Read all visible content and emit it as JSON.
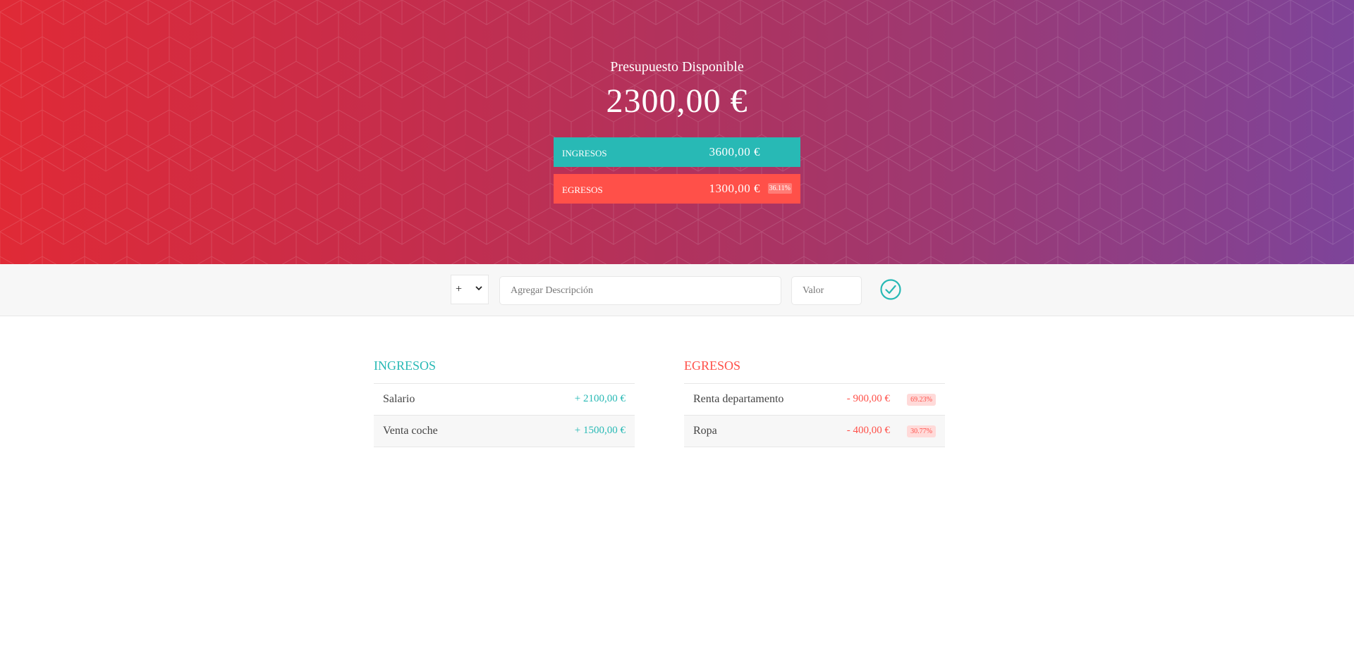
{
  "header": {
    "title": "Presupuesto Disponible",
    "budget_value": "2300,00 €",
    "colors": {
      "gradient_start": "#e02a36",
      "gradient_end": "#7d449a"
    },
    "income": {
      "label": "Ingresos",
      "value": "3600,00 €",
      "color": "#28b9b5"
    },
    "expenses": {
      "label": "Egresos",
      "value": "1300,00 €",
      "percentage": "36.11%",
      "color": "#ff5049"
    }
  },
  "add_bar": {
    "type_selected": "+",
    "description_placeholder": "Agregar Descripción",
    "value_placeholder": "Valor",
    "submit_icon": "checkmark-circle-icon"
  },
  "income_list": {
    "title": "Ingresos",
    "items": [
      {
        "description": "Salario",
        "value": "+ 2100,00 €"
      },
      {
        "description": "Venta coche",
        "value": "+ 1500,00 €"
      }
    ]
  },
  "expenses_list": {
    "title": "Egresos",
    "items": [
      {
        "description": "Renta departamento",
        "value": "- 900,00 €",
        "percentage": "69.23%"
      },
      {
        "description": "Ropa",
        "value": "- 400,00 €",
        "percentage": "30.77%"
      }
    ]
  }
}
